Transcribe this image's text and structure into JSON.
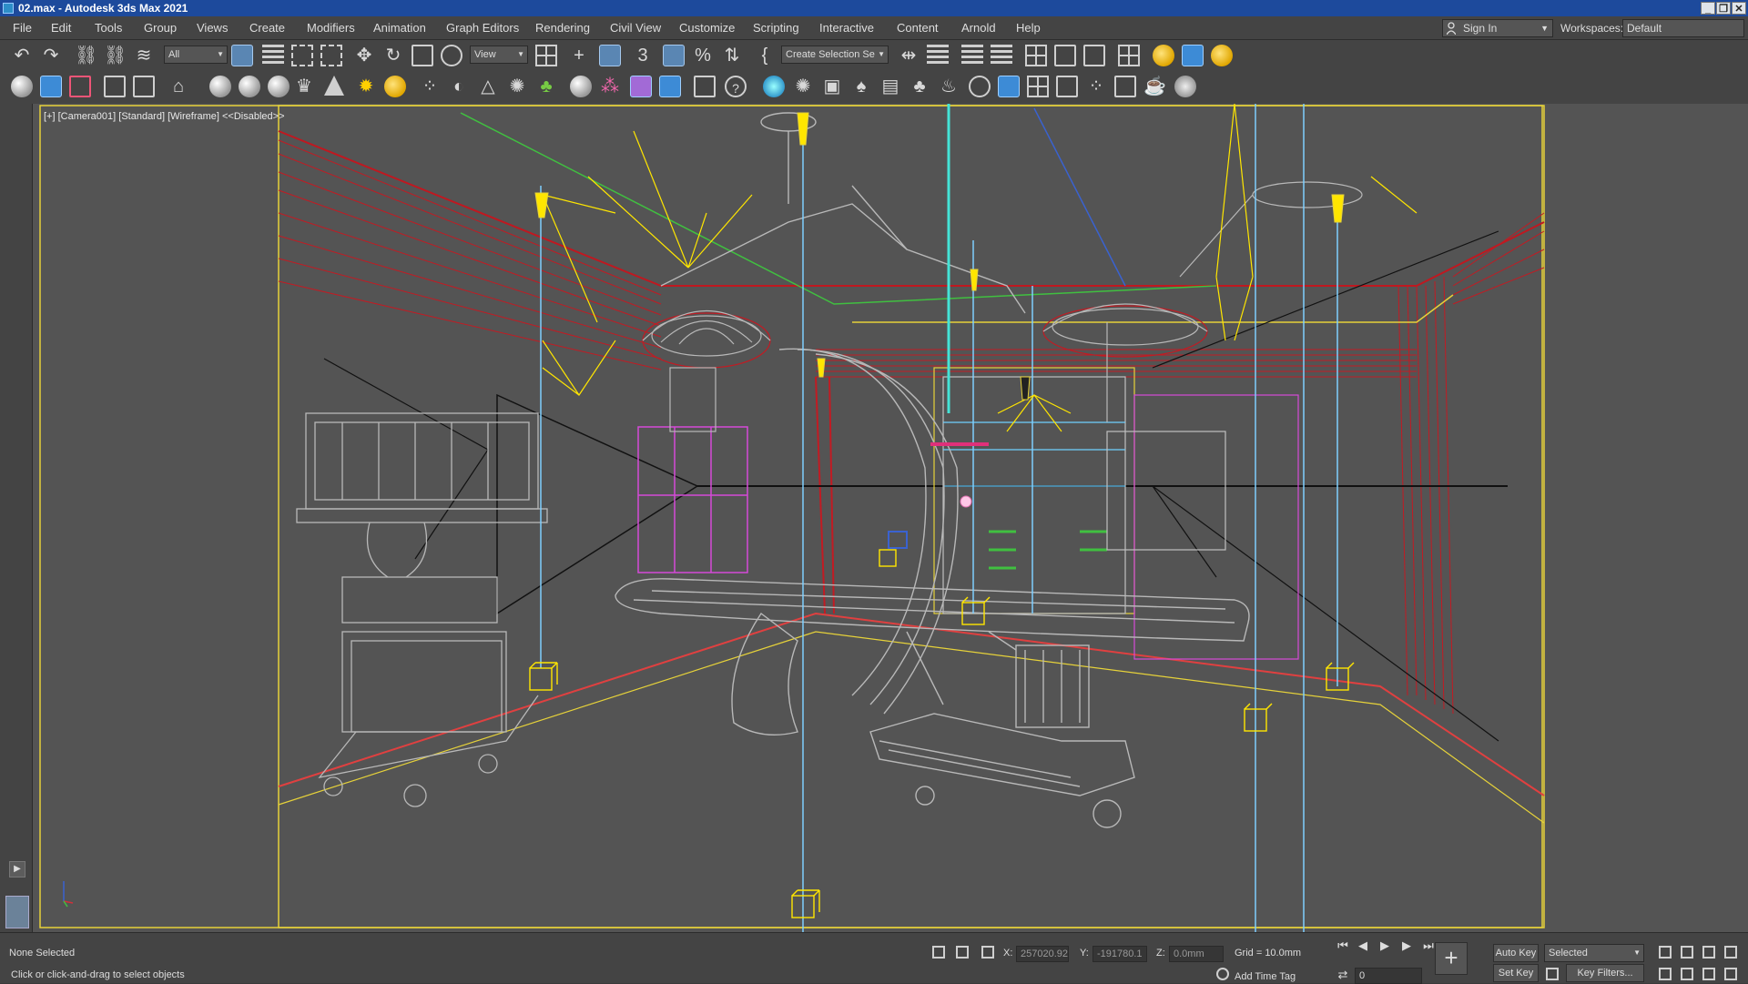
{
  "window": {
    "title": "02.max - Autodesk 3ds Max 2021",
    "controls": [
      "_",
      "❐",
      "✕"
    ]
  },
  "menu": [
    "File",
    "Edit",
    "Tools",
    "Group",
    "Views",
    "Create",
    "Modifiers",
    "Animation",
    "Graph Editors",
    "Rendering",
    "Civil View",
    "Customize",
    "Scripting",
    "Interactive",
    "Content",
    "Arnold",
    "Help"
  ],
  "account": {
    "signin_label": "Sign In",
    "workspaces_label": "Workspaces:",
    "workspace_value": "Default"
  },
  "toolbar": {
    "selection_filter": "All",
    "reference_coord": "View",
    "named_selection": "Create Selection Se",
    "icons_row1": [
      "undo-icon",
      "redo-icon",
      "link-icon",
      "unlink-icon",
      "bind-space-warp-icon",
      "select-object-icon",
      "select-by-name-icon",
      "rect-selection-region-icon",
      "window-crossing-icon",
      "select-move-icon",
      "select-rotate-icon",
      "select-scale-icon",
      "select-place-icon",
      "use-pivot-center-icon",
      "select-manipulate-icon",
      "keyboard-shortcut-toggle-icon",
      "snaps-toggle-icon",
      "angle-snap-icon",
      "percent-snap-icon",
      "spinner-snap-icon",
      "edit-named-selection-icon",
      "mirror-icon",
      "align-icon",
      "scene-explorer-icon",
      "layer-explorer-icon",
      "toggle-ribbon-icon",
      "curve-editor-icon",
      "schematic-view-icon",
      "material-editor-icon",
      "render-setup-icon",
      "rendered-frame-window-icon",
      "render-production-icon"
    ],
    "icons_row2": [
      "teapot-icon",
      "active-shade-icon",
      "render-icon",
      "plane-icon",
      "box-icon",
      "hemisphere-icon",
      "sphere-icon",
      "geosphere-icon",
      "cone-icon",
      "sun-icon",
      "light-bulb-icon",
      "particles-icon",
      "physical-material-icon",
      "bend-modifier-icon",
      "taper-modifier-icon",
      "twist-icon",
      "foliage-icon",
      "globe-icon",
      "scatter-icon",
      "material-ball-icon",
      "environment-icon",
      "xref-icon",
      "help-icon",
      "omni-light-icon",
      "spot-light-icon",
      "camera-icon",
      "tree-icon",
      "book-icon",
      "plant-icon",
      "lamp-icon",
      "render-region-icon",
      "safe-frame-icon",
      "grid-view-icon",
      "render-iterative-icon",
      "teapot-small-icon",
      "walk-through-icon",
      "light-lister-icon"
    ]
  },
  "viewport": {
    "label_plus": "[+]",
    "label_camera": "[Camera001]",
    "label_shading": "[Standard]",
    "label_mode": "[Wireframe]",
    "label_disabled": "<<Disabled>>"
  },
  "status": {
    "selection": "None Selected",
    "prompt": "Click or click-and-drag to select objects",
    "x_label": "X:",
    "x_value": "257020.92",
    "y_label": "Y:",
    "y_value": "-191780.1",
    "z_label": "Z:",
    "z_value": "0.0mm",
    "grid": "Grid = 10.0mm",
    "add_time_tag": "Add Time Tag",
    "frame": "0",
    "auto_key": "Auto Key",
    "set_key": "Set Key",
    "key_mode": "Selected",
    "key_filters": "Key Filters..."
  },
  "colors": {
    "title_bar": "#1d4a9c",
    "viewport_bg": "#545454",
    "safe_frame": "#e6d23a",
    "wire_gray": "#b8b8b8",
    "wire_red": "#d0191f",
    "light_cyan": "#7ecfff",
    "light_yellow": "#ffe600"
  }
}
